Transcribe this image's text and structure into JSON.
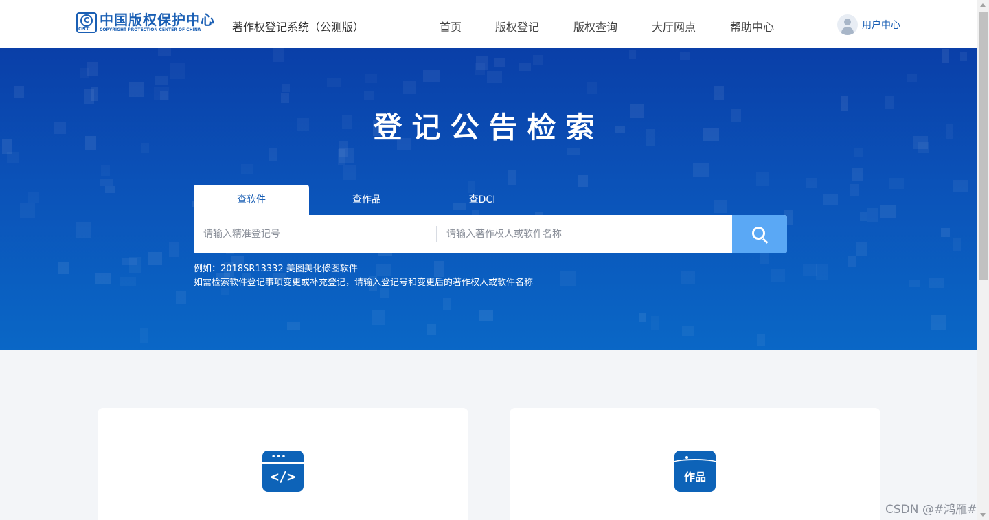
{
  "header": {
    "logo": {
      "cn": "中国版权保护中心",
      "en": "COPYRIGHT PROTECTION CENTER OF CHINA",
      "mark": "CPCC"
    },
    "system_title": "著作权登记系统（公测版）",
    "nav": [
      "首页",
      "版权登记",
      "版权查询",
      "大厅网点",
      "帮助中心"
    ],
    "user_center": "用户中心"
  },
  "hero": {
    "title": "登记公告检索",
    "tabs": [
      {
        "label": "查软件",
        "active": true
      },
      {
        "label": "查作品",
        "active": false
      },
      {
        "label": "查DCI",
        "active": false
      }
    ],
    "search": {
      "reg_number_placeholder": "请输入精准登记号",
      "name_placeholder": "请输入著作权人或软件名称"
    },
    "hints": [
      "例如：2018SR13332 美图美化修图软件",
      "如需检索软件登记事项变更或补充登记，请输入登记号和变更后的著作权人或软件名称"
    ]
  },
  "cards": [
    {
      "icon": "code-icon",
      "glyph": "</>"
    },
    {
      "icon": "work-icon",
      "label": "作品"
    }
  ],
  "colors": {
    "brand": "#1a5fb4",
    "hero_top": "#0a3fa8",
    "hero_bottom": "#0a67c6",
    "search_button": "#5aa8f5",
    "card_icon": "#0d63b8",
    "page_bg": "#f3f5f8"
  },
  "watermark": "CSDN @#鸿雁#"
}
